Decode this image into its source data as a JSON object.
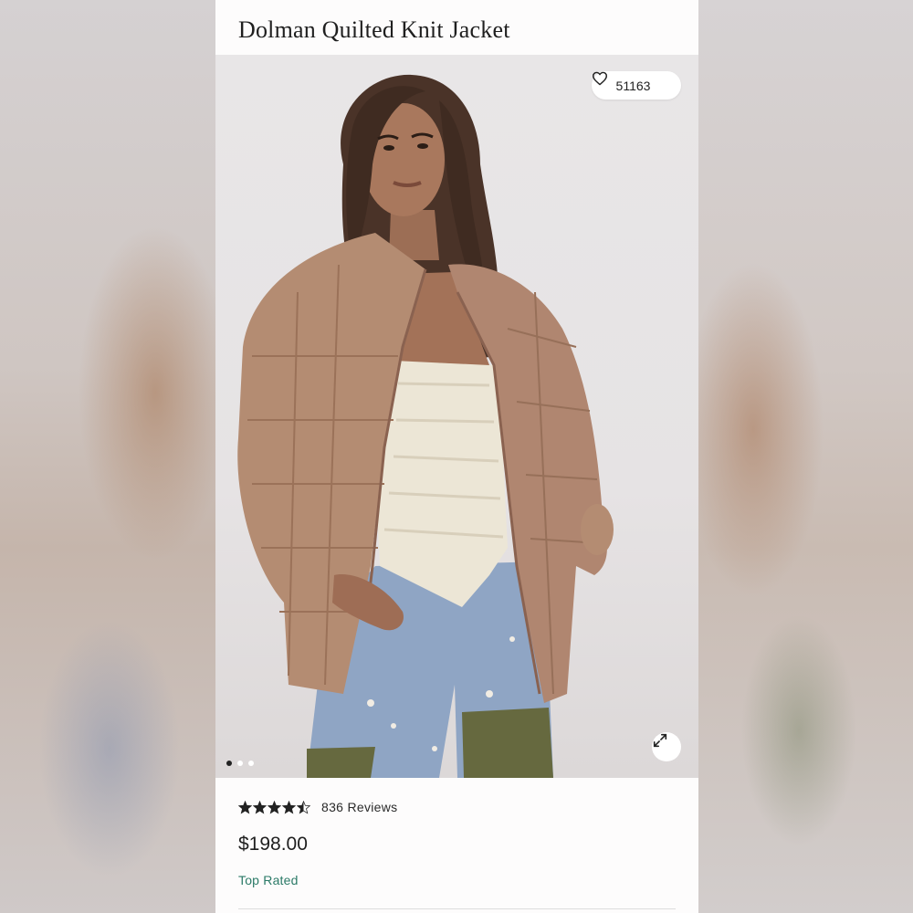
{
  "product": {
    "title": "Dolman Quilted Knit Jacket",
    "like_count": "51163",
    "rating_value": 4.5,
    "reviews_label": "836 Reviews",
    "price": "$198.00",
    "badge": "Top Rated"
  },
  "carousel": {
    "slide_count": 3,
    "active_index": 0
  },
  "icons": {
    "like": "heart-icon",
    "expand": "expand-arrows-icon",
    "star": "star-icon"
  },
  "colors": {
    "badge": "#2b7a67",
    "jacket": "#b48c72",
    "card_bg": "#fdfcfc"
  }
}
